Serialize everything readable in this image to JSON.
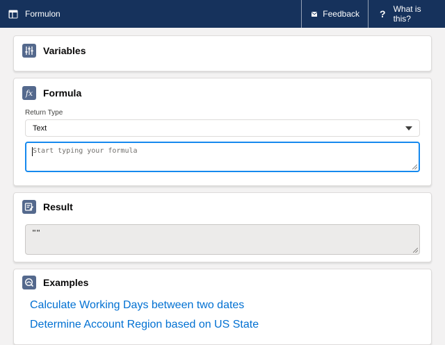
{
  "header": {
    "app_title": "Formulon",
    "feedback_label": "Feedback",
    "help_label": "What is this?",
    "help_glyph": "?"
  },
  "variables": {
    "title": "Variables",
    "icon": "sliders-icon"
  },
  "formula": {
    "title": "Formula",
    "icon": "function-fx-icon",
    "icon_text": "fx",
    "return_type_label": "Return Type",
    "return_type_value": "Text",
    "input_value": "",
    "input_placeholder": "Start typing your formula"
  },
  "result": {
    "title": "Result",
    "icon": "result-icon",
    "value": "\"\""
  },
  "examples": {
    "title": "Examples",
    "icon": "examples-icon",
    "items": [
      "Calculate Working Days between two dates",
      "Determine Account Region based on US State"
    ]
  },
  "colors": {
    "header_bg": "#16325c",
    "icon_bg": "#54698d",
    "focus_border": "#1589ee",
    "link": "#0070d2",
    "page_bg": "#f3f2f2"
  }
}
